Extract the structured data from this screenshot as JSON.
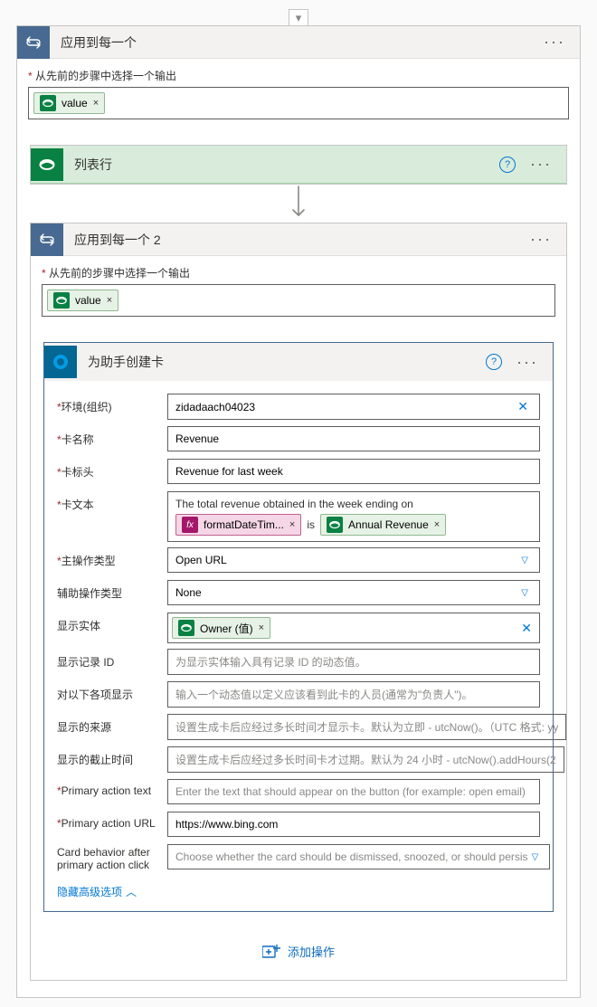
{
  "foreach1": {
    "title": "应用到每一个",
    "caption": "从先前的步骤中选择一个输出",
    "required_mark": "*",
    "pill_label": "value",
    "pill_close": "×"
  },
  "listRows": {
    "title": "列表行"
  },
  "foreach2": {
    "title": "应用到每一个 2",
    "caption": "从先前的步骤中选择一个输出",
    "required_mark": "*",
    "pill_label": "value",
    "pill_close": "×"
  },
  "createCard": {
    "title": "为助手创建卡",
    "fields": {
      "env": {
        "label": "环境(组织)",
        "required": "*",
        "value": "zidadaach04023"
      },
      "name": {
        "label": "卡名称",
        "required": "*",
        "value": "Revenue"
      },
      "headerText": {
        "label": "卡标头",
        "required": "*",
        "value": "Revenue for last week"
      },
      "cardText": {
        "label": "卡文本",
        "required": "*",
        "line1": "The total revenue obtained in the week ending on",
        "pill1": "formatDateTim...",
        "joiner": "is",
        "pill2": "Annual Revenue",
        "pill_close": "×"
      },
      "primaryType": {
        "label": "主操作类型",
        "required": "*",
        "value": "Open URL"
      },
      "secondaryType": {
        "label": "辅助操作类型",
        "value": "None"
      },
      "displayEntity": {
        "label": "显示实体",
        "pill": "Owner (值)",
        "pill_close": "×"
      },
      "recordId": {
        "label": "显示记录 ID",
        "placeholder": "为显示实体输入具有记录 ID 的动态值。"
      },
      "displayFor": {
        "label": "对以下各项显示",
        "placeholder": "输入一个动态值以定义应该看到此卡的人员(通常为\"负责人\")。"
      },
      "showFrom": {
        "label": "显示的来源",
        "placeholder": "设置生成卡后应经过多长时间才显示卡。默认为立即 - utcNow()。（UTC 格式: yy"
      },
      "showUntil": {
        "label": "显示的截止时间",
        "placeholder": "设置生成卡后应经过多长时间卡才过期。默认为 24 小时 - utcNow().addHours(2"
      },
      "primaryActionText": {
        "label": "Primary action text",
        "required": "*",
        "placeholder": "Enter the text that should appear on the button (for example: open email)"
      },
      "primaryActionUrl": {
        "label": "Primary action URL",
        "required": "*",
        "value": "https://www.bing.com"
      },
      "cardBehavior": {
        "label": "Card behavior after primary action click",
        "placeholder": "Choose whether the card should be dismissed, snoozed, or should persis"
      }
    },
    "hideAdvanced": "隐藏高级选项"
  },
  "addAction": "添加操作"
}
